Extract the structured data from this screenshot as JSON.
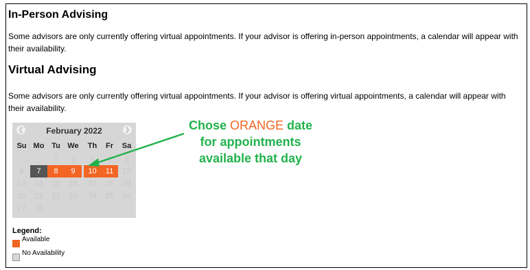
{
  "inperson": {
    "heading": "In-Person Advising",
    "text": "Some advisors are only currently offering virtual appointments. If your advisor is offering in-person appointments, a calendar will appear with their availability."
  },
  "virtual": {
    "heading": "Virtual Advising",
    "text": "Some advisors are only currently offering virtual appointments. If your advisor is offering virtual appointments, a calendar will appear with their availability."
  },
  "calendar": {
    "month": "February 2022",
    "prev_icon": "chevron-left-icon",
    "next_icon": "chevron-right-icon",
    "weekdays": [
      "Su",
      "Mo",
      "Tu",
      "We",
      "Th",
      "Fr",
      "Sa"
    ],
    "weeks": [
      [
        {
          "d": ""
        },
        {
          "d": ""
        },
        {
          "d": "1"
        },
        {
          "d": "2"
        },
        {
          "d": "3"
        },
        {
          "d": "4"
        },
        {
          "d": "5"
        }
      ],
      [
        {
          "d": "6"
        },
        {
          "d": "7",
          "state": "selected"
        },
        {
          "d": "8",
          "state": "available"
        },
        {
          "d": "9",
          "state": "available"
        },
        {
          "d": "10",
          "state": "available"
        },
        {
          "d": "11",
          "state": "available"
        },
        {
          "d": "12"
        }
      ],
      [
        {
          "d": "13"
        },
        {
          "d": "14"
        },
        {
          "d": "15"
        },
        {
          "d": "16"
        },
        {
          "d": "17"
        },
        {
          "d": "18"
        },
        {
          "d": "19"
        }
      ],
      [
        {
          "d": "20"
        },
        {
          "d": "21"
        },
        {
          "d": "22"
        },
        {
          "d": "23"
        },
        {
          "d": "24"
        },
        {
          "d": "25"
        },
        {
          "d": "26"
        }
      ],
      [
        {
          "d": "27"
        },
        {
          "d": "28"
        },
        {
          "d": ""
        },
        {
          "d": ""
        },
        {
          "d": ""
        },
        {
          "d": ""
        },
        {
          "d": ""
        }
      ]
    ],
    "colors": {
      "available": "#f26522",
      "selected": "#555555",
      "background": "#d6d6d6"
    }
  },
  "annotation": {
    "part1": "Chose ",
    "highlight": "ORANGE",
    "part2": " date",
    "line2": "for appointments",
    "line3": "available that day",
    "color": "#22b24c",
    "highlight_color": "#f26522"
  },
  "legend": {
    "title": "Legend:",
    "available": "Available",
    "none": "No Availability"
  }
}
